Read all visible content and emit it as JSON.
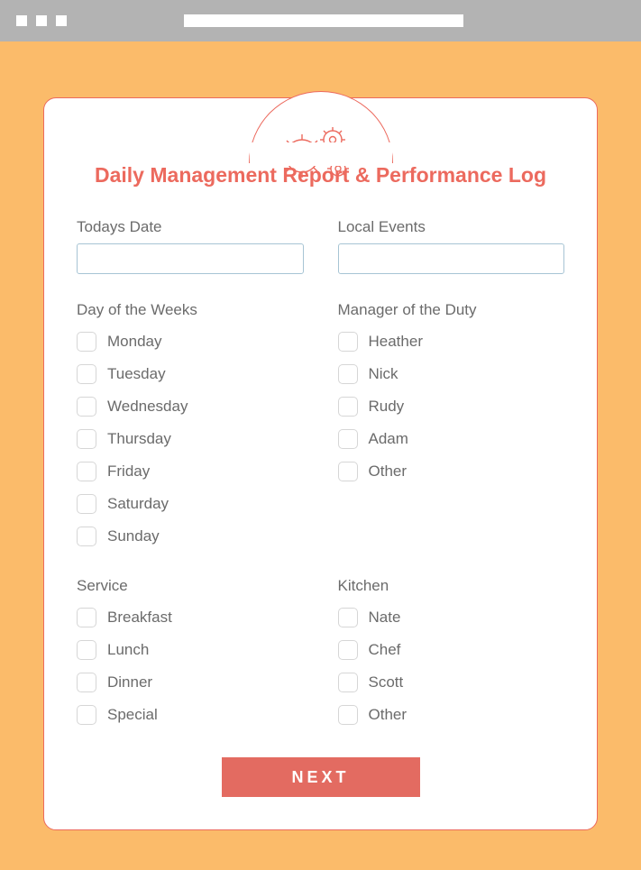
{
  "title": "Daily Management Report & Performance Log",
  "fields": {
    "date_label": "Todays Date",
    "date_value": "",
    "events_label": "Local Events",
    "events_value": ""
  },
  "sections": {
    "days": {
      "label": "Day of the Weeks",
      "items": [
        "Monday",
        "Tuesday",
        "Wednesday",
        "Thursday",
        "Friday",
        "Saturday",
        "Sunday"
      ]
    },
    "manager": {
      "label": "Manager of the Duty",
      "items": [
        "Heather",
        "Nick",
        "Rudy",
        "Adam",
        "Other"
      ]
    },
    "service": {
      "label": "Service",
      "items": [
        "Breakfast",
        "Lunch",
        "Dinner",
        "Special"
      ]
    },
    "kitchen": {
      "label": "Kitchen",
      "items": [
        "Nate",
        "Chef",
        "Scott",
        "Other"
      ]
    }
  },
  "next_label": "NEXT"
}
